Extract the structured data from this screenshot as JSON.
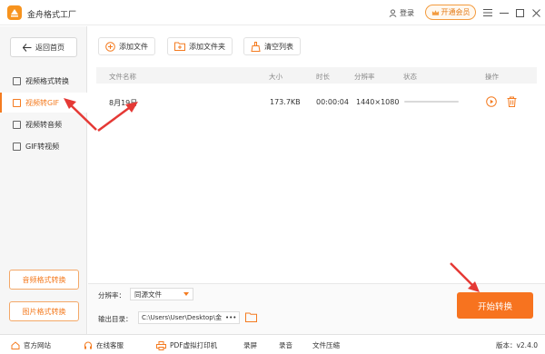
{
  "app": {
    "title": "金舟格式工厂"
  },
  "header": {
    "login_label": "登录",
    "vip_label": "开通会员"
  },
  "sidebar": {
    "back_label": "返回首页",
    "items": [
      {
        "label": "视频格式转换"
      },
      {
        "label": "视频转GIF"
      },
      {
        "label": "视频转音频"
      },
      {
        "label": "GIF转视频"
      }
    ],
    "bottom_buttons": [
      {
        "label": "音频格式转换"
      },
      {
        "label": "图片格式转换"
      }
    ]
  },
  "toolbar": {
    "add_file": "添加文件",
    "add_folder": "添加文件夹",
    "clear_list": "清空列表"
  },
  "table": {
    "headers": [
      "文件名称",
      "大小",
      "时长",
      "分辨率",
      "状态",
      "操作"
    ],
    "rows": [
      {
        "name": "8月19日",
        "size": "173.7KB",
        "duration": "00:00:04",
        "resolution": "1440×1080",
        "progress": 0
      }
    ]
  },
  "settings": {
    "resolution_label": "分辨率：",
    "resolution_value": "同源文件",
    "output_label": "输出目录：",
    "output_path": "C:\\Users\\User\\Desktop\\金",
    "more_label": "•••"
  },
  "start_button": "开始转换",
  "footer": {
    "items": [
      "官方网站",
      "在线客服",
      "PDF虚拟打印机",
      "录屏",
      "录音",
      "文件压缩"
    ],
    "version": "版本：v2.4.0"
  },
  "colors": {
    "accent": "#f47b20",
    "annotation_arrow": "#e53935"
  }
}
